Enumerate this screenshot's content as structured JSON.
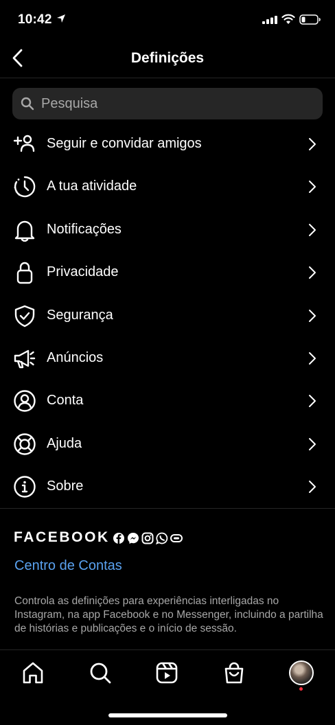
{
  "status_bar": {
    "time": "10:42"
  },
  "header": {
    "title": "Definições"
  },
  "search": {
    "placeholder": "Pesquisa"
  },
  "menu": {
    "items": [
      {
        "label": "Seguir e convidar amigos",
        "icon": "add-person-icon"
      },
      {
        "label": "A tua atividade",
        "icon": "activity-clock-icon"
      },
      {
        "label": "Notificações",
        "icon": "bell-icon"
      },
      {
        "label": "Privacidade",
        "icon": "lock-icon"
      },
      {
        "label": "Segurança",
        "icon": "shield-check-icon"
      },
      {
        "label": "Anúncios",
        "icon": "megaphone-icon"
      },
      {
        "label": "Conta",
        "icon": "account-circle-icon"
      },
      {
        "label": "Ajuda",
        "icon": "lifebuoy-icon"
      },
      {
        "label": "Sobre",
        "icon": "info-icon"
      }
    ]
  },
  "facebook": {
    "wordmark": "FACEBOOK",
    "accounts_center_label": "Centro de Contas",
    "description": "Controla as definições para experiências interligadas no Instagram, na app Facebook e no Messenger, incluindo a partilha de histórias e publicações e o início de sessão."
  },
  "tab_bar": {
    "tabs": [
      "home-icon",
      "search-icon",
      "reels-icon",
      "shop-icon",
      "profile-avatar"
    ]
  },
  "colors": {
    "background": "#000000",
    "link": "#5aa2f0",
    "search_bg": "#262626",
    "notification_dot": "#ff3040"
  }
}
